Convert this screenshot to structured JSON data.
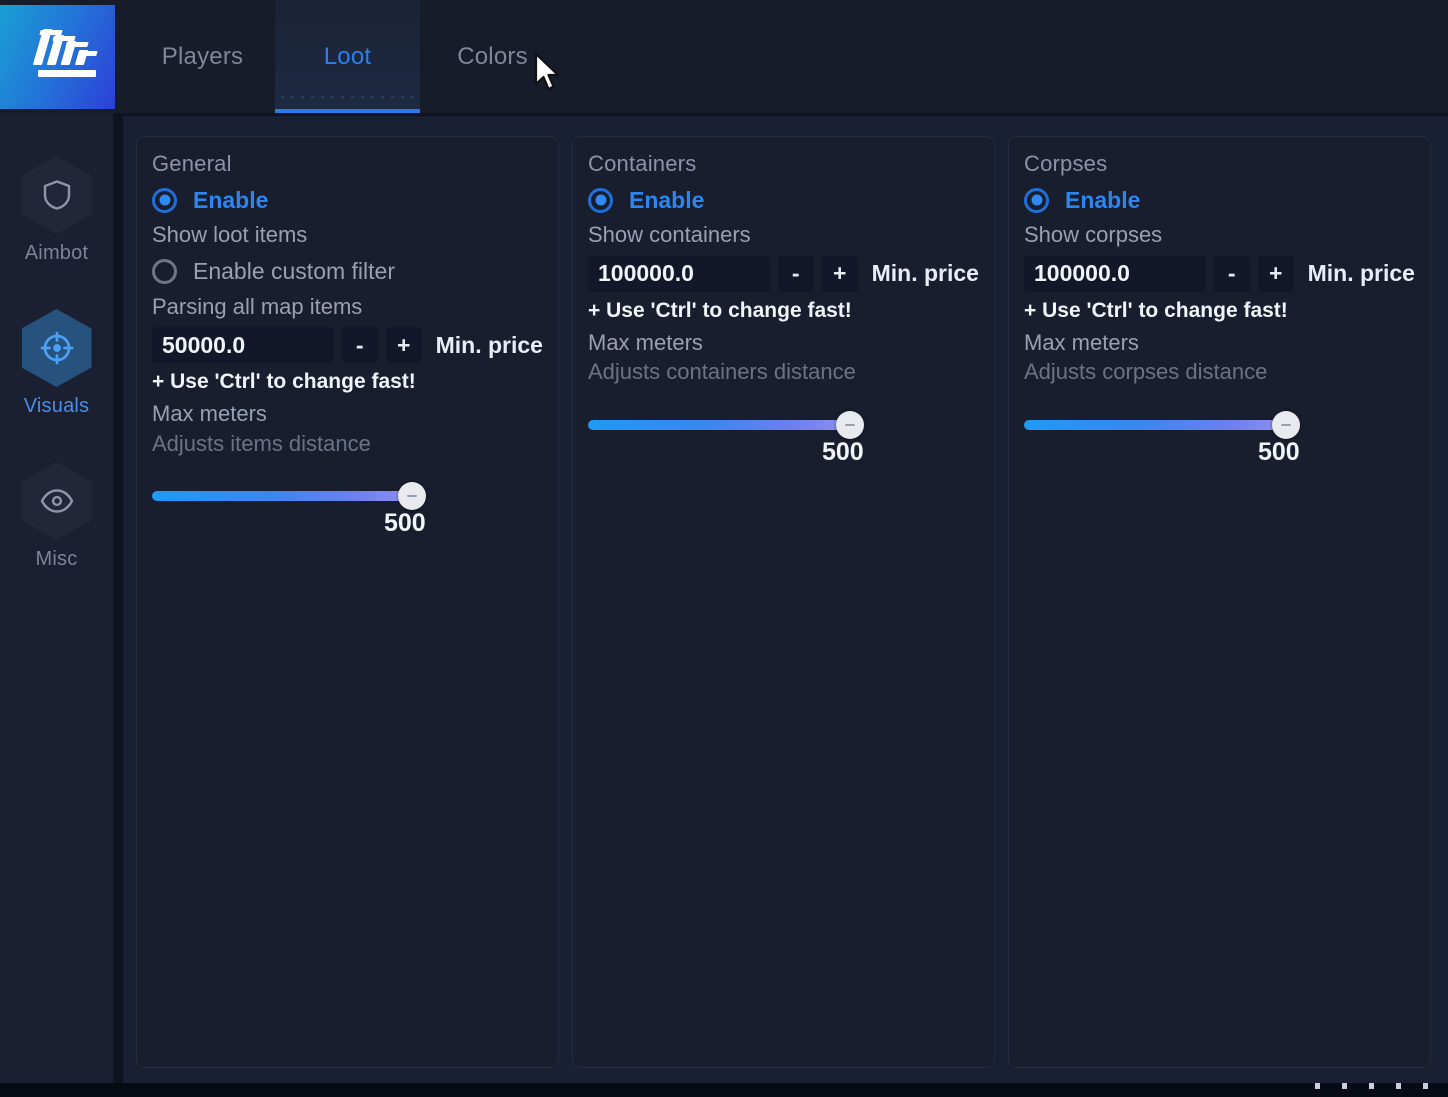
{
  "app": {
    "logo_name": "app-logo",
    "accent_color": "#2979e8",
    "panel_bg": "#181e2e",
    "sidebar_bg": "#1a1f31"
  },
  "header": {
    "tabs": [
      {
        "label": "Players",
        "active": false
      },
      {
        "label": "Loot",
        "active": true
      },
      {
        "label": "Colors",
        "active": false
      }
    ]
  },
  "sidebar": {
    "items": [
      {
        "label": "Aimbot",
        "icon": "shield-icon",
        "active": false
      },
      {
        "label": "Visuals",
        "icon": "crosshair-icon",
        "active": true
      },
      {
        "label": "Misc",
        "icon": "eye-icon",
        "active": false
      }
    ]
  },
  "panels": [
    {
      "title": "General",
      "enable": {
        "label": "Enable",
        "checked": true
      },
      "enable_desc": "Show loot items",
      "custom_filter": {
        "label": "Enable custom filter",
        "checked": false
      },
      "custom_filter_desc": "Parsing all map items",
      "price": {
        "value": "50000.0",
        "minus": "-",
        "plus": "+",
        "label": "Min. price",
        "hint": "+ Use 'Ctrl' to change fast!"
      },
      "slider": {
        "title": "Max meters",
        "desc": "Adjusts items distance",
        "value": "500",
        "min": 0,
        "max": 500,
        "current": 500
      }
    },
    {
      "title": "Containers",
      "enable": {
        "label": "Enable",
        "checked": true
      },
      "enable_desc": "Show containers",
      "price": {
        "value": "100000.0",
        "minus": "-",
        "plus": "+",
        "label": "Min. price",
        "hint": "+ Use 'Ctrl' to change fast!"
      },
      "slider": {
        "title": "Max meters",
        "desc": "Adjusts containers distance",
        "value": "500",
        "min": 0,
        "max": 500,
        "current": 500
      }
    },
    {
      "title": "Corpses",
      "enable": {
        "label": "Enable",
        "checked": true
      },
      "enable_desc": "Show corpses",
      "price": {
        "value": "100000.0",
        "minus": "-",
        "plus": "+",
        "label": "Min. price",
        "hint": "+ Use 'Ctrl' to change fast!"
      },
      "slider": {
        "title": "Max meters",
        "desc": "Adjusts corpses distance",
        "value": "500",
        "min": 0,
        "max": 500,
        "current": 500
      }
    }
  ]
}
